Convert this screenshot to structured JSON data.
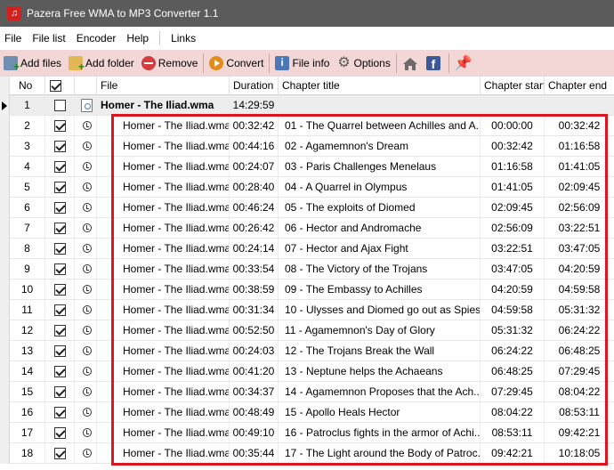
{
  "window": {
    "title": "Pazera Free WMA to MP3 Converter 1.1"
  },
  "menu": [
    "File",
    "File list",
    "Encoder",
    "Help",
    "Links"
  ],
  "toolbar": {
    "add_files": "Add files",
    "add_folder": "Add folder",
    "remove": "Remove",
    "convert": "Convert",
    "file_info": "File info",
    "options": "Options"
  },
  "columns": {
    "no": "No",
    "file": "File",
    "duration": "Duration",
    "chapter_title": "Chapter title",
    "chapter_start": "Chapter start",
    "chapter_end": "Chapter end"
  },
  "parent_row": {
    "no": "1",
    "file": "Homer - The Iliad.wma",
    "duration": "14:29:59"
  },
  "rows": [
    {
      "no": "2",
      "file": "Homer - The Iliad.wma",
      "duration": "00:32:42",
      "title": "01 - The Quarrel between Achilles and A...",
      "start": "00:00:00",
      "end": "00:32:42"
    },
    {
      "no": "3",
      "file": "Homer - The Iliad.wma",
      "duration": "00:44:16",
      "title": "02 - Agamemnon's Dream",
      "start": "00:32:42",
      "end": "01:16:58"
    },
    {
      "no": "4",
      "file": "Homer - The Iliad.wma",
      "duration": "00:24:07",
      "title": "03 - Paris Challenges Menelaus",
      "start": "01:16:58",
      "end": "01:41:05"
    },
    {
      "no": "5",
      "file": "Homer - The Iliad.wma",
      "duration": "00:28:40",
      "title": "04 - A Quarrel in Olympus",
      "start": "01:41:05",
      "end": "02:09:45"
    },
    {
      "no": "6",
      "file": "Homer - The Iliad.wma",
      "duration": "00:46:24",
      "title": "05 - The exploits of Diomed",
      "start": "02:09:45",
      "end": "02:56:09"
    },
    {
      "no": "7",
      "file": "Homer - The Iliad.wma",
      "duration": "00:26:42",
      "title": "06 - Hector and Andromache",
      "start": "02:56:09",
      "end": "03:22:51"
    },
    {
      "no": "8",
      "file": "Homer - The Iliad.wma",
      "duration": "00:24:14",
      "title": "07 - Hector and Ajax Fight",
      "start": "03:22:51",
      "end": "03:47:05"
    },
    {
      "no": "9",
      "file": "Homer - The Iliad.wma",
      "duration": "00:33:54",
      "title": "08 - The Victory of the Trojans",
      "start": "03:47:05",
      "end": "04:20:59"
    },
    {
      "no": "10",
      "file": "Homer - The Iliad.wma",
      "duration": "00:38:59",
      "title": "09 - The Embassy to Achilles",
      "start": "04:20:59",
      "end": "04:59:58"
    },
    {
      "no": "11",
      "file": "Homer - The Iliad.wma",
      "duration": "00:31:34",
      "title": "10 - Ulysses and Diomed go out as Spies",
      "start": "04:59:58",
      "end": "05:31:32"
    },
    {
      "no": "12",
      "file": "Homer - The Iliad.wma",
      "duration": "00:52:50",
      "title": "11 - Agamemnon's Day of Glory",
      "start": "05:31:32",
      "end": "06:24:22"
    },
    {
      "no": "13",
      "file": "Homer - The Iliad.wma",
      "duration": "00:24:03",
      "title": "12 - The Trojans Break the Wall",
      "start": "06:24:22",
      "end": "06:48:25"
    },
    {
      "no": "14",
      "file": "Homer - The Iliad.wma",
      "duration": "00:41:20",
      "title": "13 - Neptune helps the Achaeans",
      "start": "06:48:25",
      "end": "07:29:45"
    },
    {
      "no": "15",
      "file": "Homer - The Iliad.wma",
      "duration": "00:34:37",
      "title": "14 - Agamemnon Proposes that the Ach...",
      "start": "07:29:45",
      "end": "08:04:22"
    },
    {
      "no": "16",
      "file": "Homer - The Iliad.wma",
      "duration": "00:48:49",
      "title": "15 - Apollo Heals Hector",
      "start": "08:04:22",
      "end": "08:53:11"
    },
    {
      "no": "17",
      "file": "Homer - The Iliad.wma",
      "duration": "00:49:10",
      "title": "16 - Patroclus fights in the armor of Achi...",
      "start": "08:53:11",
      "end": "09:42:21"
    },
    {
      "no": "18",
      "file": "Homer - The Iliad.wma",
      "duration": "00:35:44",
      "title": "17 - The Light around the Body of Patroc...",
      "start": "09:42:21",
      "end": "10:18:05"
    }
  ]
}
